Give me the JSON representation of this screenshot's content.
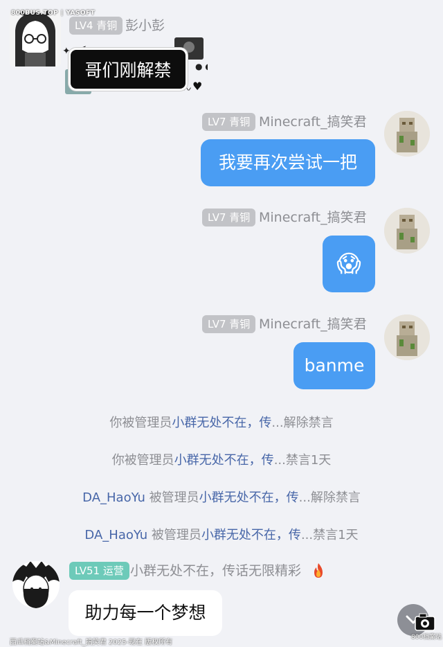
{
  "messages": [
    {
      "sender": "彭小彭",
      "level": "LV4 青铜",
      "side": "left",
      "sticker_text": "哥们刚解禁"
    },
    {
      "sender": "Minecraft_搞笑君",
      "level": "LV7 青铜",
      "side": "right",
      "text": "我要再次尝试一把"
    },
    {
      "sender": "Minecraft_搞笑君",
      "level": "LV7 青铜",
      "side": "right",
      "text": "😱"
    },
    {
      "sender": "Minecraft_搞笑君",
      "level": "LV7 青铜",
      "side": "right",
      "text": "banme"
    }
  ],
  "system_notices": [
    {
      "prefix": "你被管理员",
      "name": "小群无处不在，传",
      "suffix": "...解除禁言"
    },
    {
      "prefix": "你被管理员",
      "name": "小群无处不在，传",
      "suffix": "...禁言1天"
    },
    {
      "who": "DA_HaoYu",
      "prefix": " 被管理员",
      "name": "小群无处不在，传",
      "suffix": "...解除禁言"
    },
    {
      "who": "DA_HaoYu",
      "prefix": " 被管理员",
      "name": "小群无处不在，传",
      "suffix": "...禁言1天"
    }
  ],
  "last_message": {
    "sender": "小群无处不在，传话无限精彩",
    "level": "LV51 运营",
    "text": "助力每一个梦想",
    "sender_icon": "fire-icon"
  },
  "watermarks": {
    "top": "800BUS.TOP | YASOFT",
    "bottom": "西瓜档案站&Minecraft_搞笑君 2025-现在 版权所有",
    "logo_text": "800档案站"
  },
  "scroll_button_icon": "chevron-down-icon",
  "colors": {
    "self_bubble": "#4a9df3",
    "badge_gray": "#c2c3c7",
    "badge_teal": "#6dcab9",
    "admin_name": "#4766a8"
  }
}
